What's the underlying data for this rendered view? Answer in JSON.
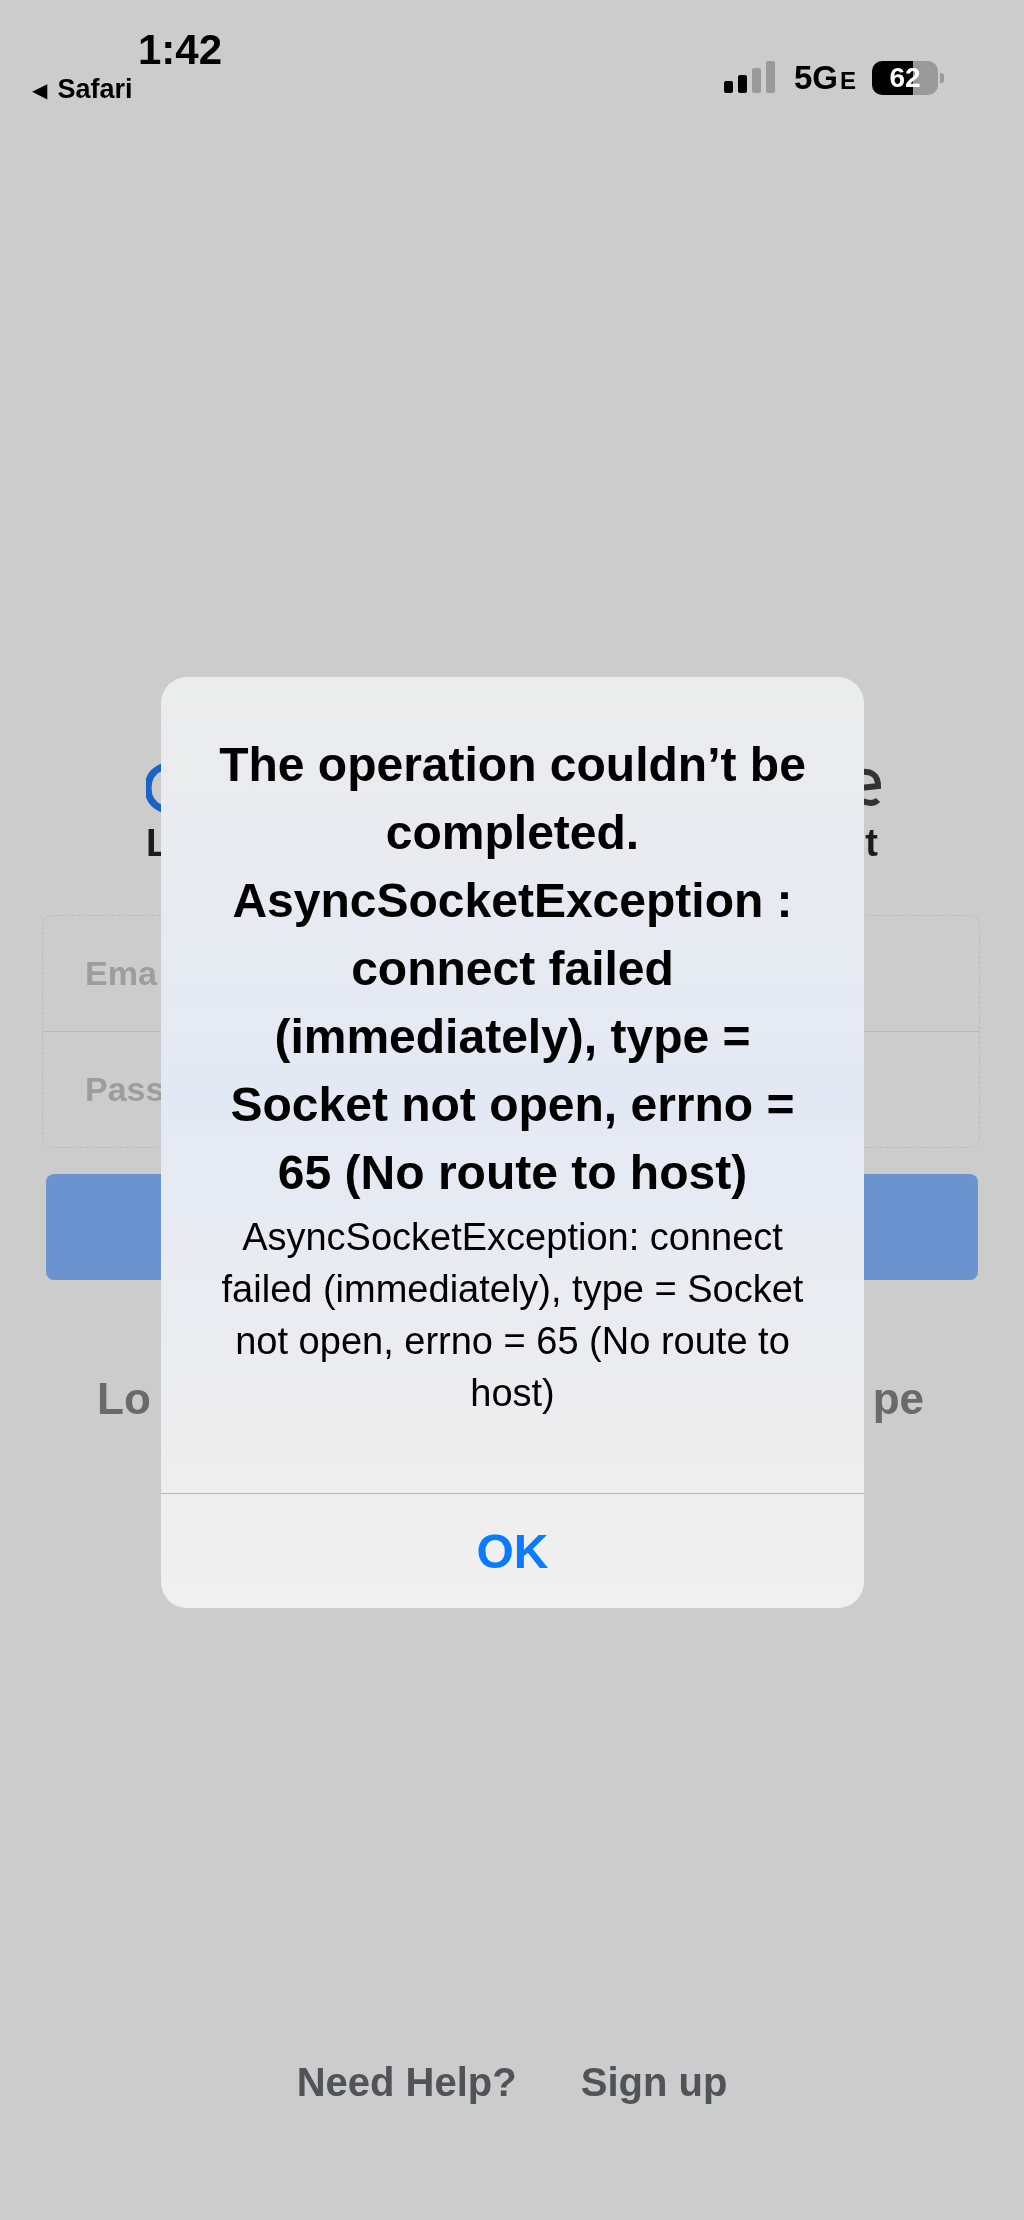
{
  "status_bar": {
    "time": "1:42",
    "back_app": "Safari",
    "back_glyph": "◀",
    "network": "5G",
    "network_suffix": "E",
    "battery": "62"
  },
  "background": {
    "subtitle_left": "L",
    "subtitle_right": "t",
    "email_placeholder": "Ema",
    "password_placeholder": "Pass",
    "login_left": "Lo",
    "login_right": "pe",
    "links": [
      "Need Help?",
      "Sign up"
    ]
  },
  "alert": {
    "title": "The operation couldn’t be completed. AsyncSocketException : connect failed (immediately), type = Socket not open, errno = 65 (No route to host)",
    "message": "AsyncSocketException: connect failed (immediately), type = Socket not open, errno = 65 (No route to host)",
    "buttons": [
      "OK"
    ]
  }
}
